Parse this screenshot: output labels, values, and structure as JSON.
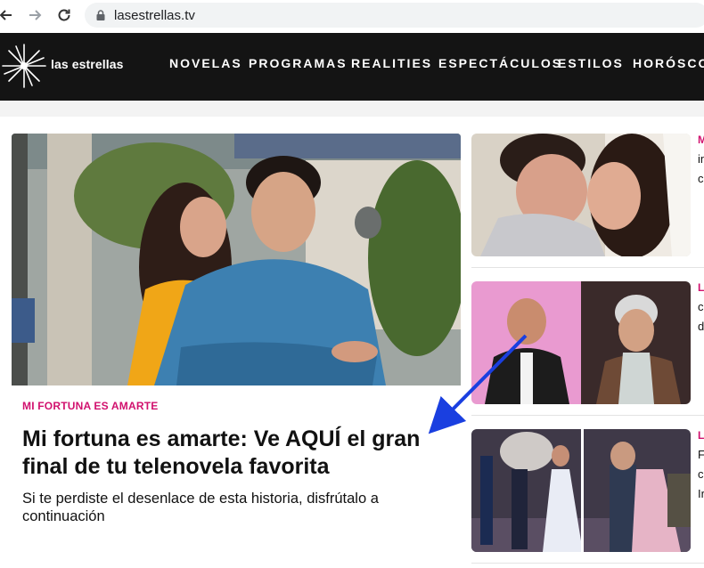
{
  "browser": {
    "url": "lasestrellas.tv",
    "back_icon": "arrow-left-icon",
    "forward_icon": "arrow-right-icon",
    "reload_icon": "reload-icon",
    "lock_icon": "lock-icon"
  },
  "site": {
    "logo_text": "las estrellas",
    "logo_icon": "star-burst-icon",
    "nav": [
      "NOVELAS",
      "PROGRAMAS",
      "REALITIES",
      "ESPECTÁCULOS",
      "ESTILOS",
      "HORÓSCOP"
    ]
  },
  "main_article": {
    "kicker": "MI FORTUNA ES AMARTE",
    "headline": "Mi fortuna es amarte: Ve AQUÍ el gran final de tu telenovela favorita",
    "summary": "Si te perdiste el desenlace de esta historia, disfrútalo a continuación"
  },
  "side_articles": [
    {
      "kicker": "M",
      "lines": [
        "M",
        "in",
        "c"
      ]
    },
    {
      "kicker": "L",
      "lines": [
        "L",
        "c",
        "d"
      ]
    },
    {
      "kicker": "L",
      "lines": [
        "F",
        "c",
        "Ir"
      ]
    }
  ],
  "colors": {
    "accent": "#d1116e",
    "header_bg": "#141414",
    "annotation_arrow": "#1a3fe0"
  }
}
